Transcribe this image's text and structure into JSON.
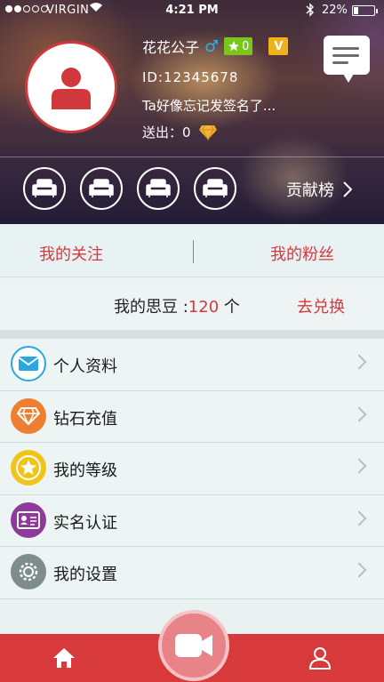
{
  "status_bar": {
    "carrier": "VIRGIN",
    "time": "4:21 PM",
    "battery": "22%",
    "signal_dots_filled": 2,
    "signal_dots_total": 5
  },
  "profile": {
    "nickname": "花花公子",
    "gender_symbol": "♂",
    "star_badge": "0",
    "v_badge": "V",
    "id": "ID:12345678",
    "signature": "Ta好像忘记发签名了...",
    "sent_label": "送出：0",
    "avatar_icon": "user-icon",
    "message_icon": "chat-icon"
  },
  "seats": {
    "count": 4,
    "icon": "sofa-icon",
    "rank_label": "贡献榜"
  },
  "follow": {
    "following": "我的关注",
    "divider": "|",
    "fans": "我的粉丝"
  },
  "beans": {
    "label": "我的思豆 :",
    "amount": "120",
    "unit": " 个",
    "exchange": "去兑换"
  },
  "menu": [
    {
      "label": "个人资料",
      "icon": "envelope-icon",
      "color": "#2aa6e0"
    },
    {
      "label": "钻石充值",
      "icon": "diamond-icon",
      "color": "#ef7f30"
    },
    {
      "label": "我的等级",
      "icon": "star-icon",
      "color": "#f0c419"
    },
    {
      "label": "实名认证",
      "icon": "id-card-icon",
      "color": "#8e3a9a"
    },
    {
      "label": "我的设置",
      "icon": "gear-icon",
      "color": "#7f8c8d"
    }
  ],
  "tabbar": {
    "home_icon": "home-icon",
    "record_icon": "video-camera-icon",
    "me_icon": "person-icon",
    "bar_color": "#d83a3c"
  }
}
